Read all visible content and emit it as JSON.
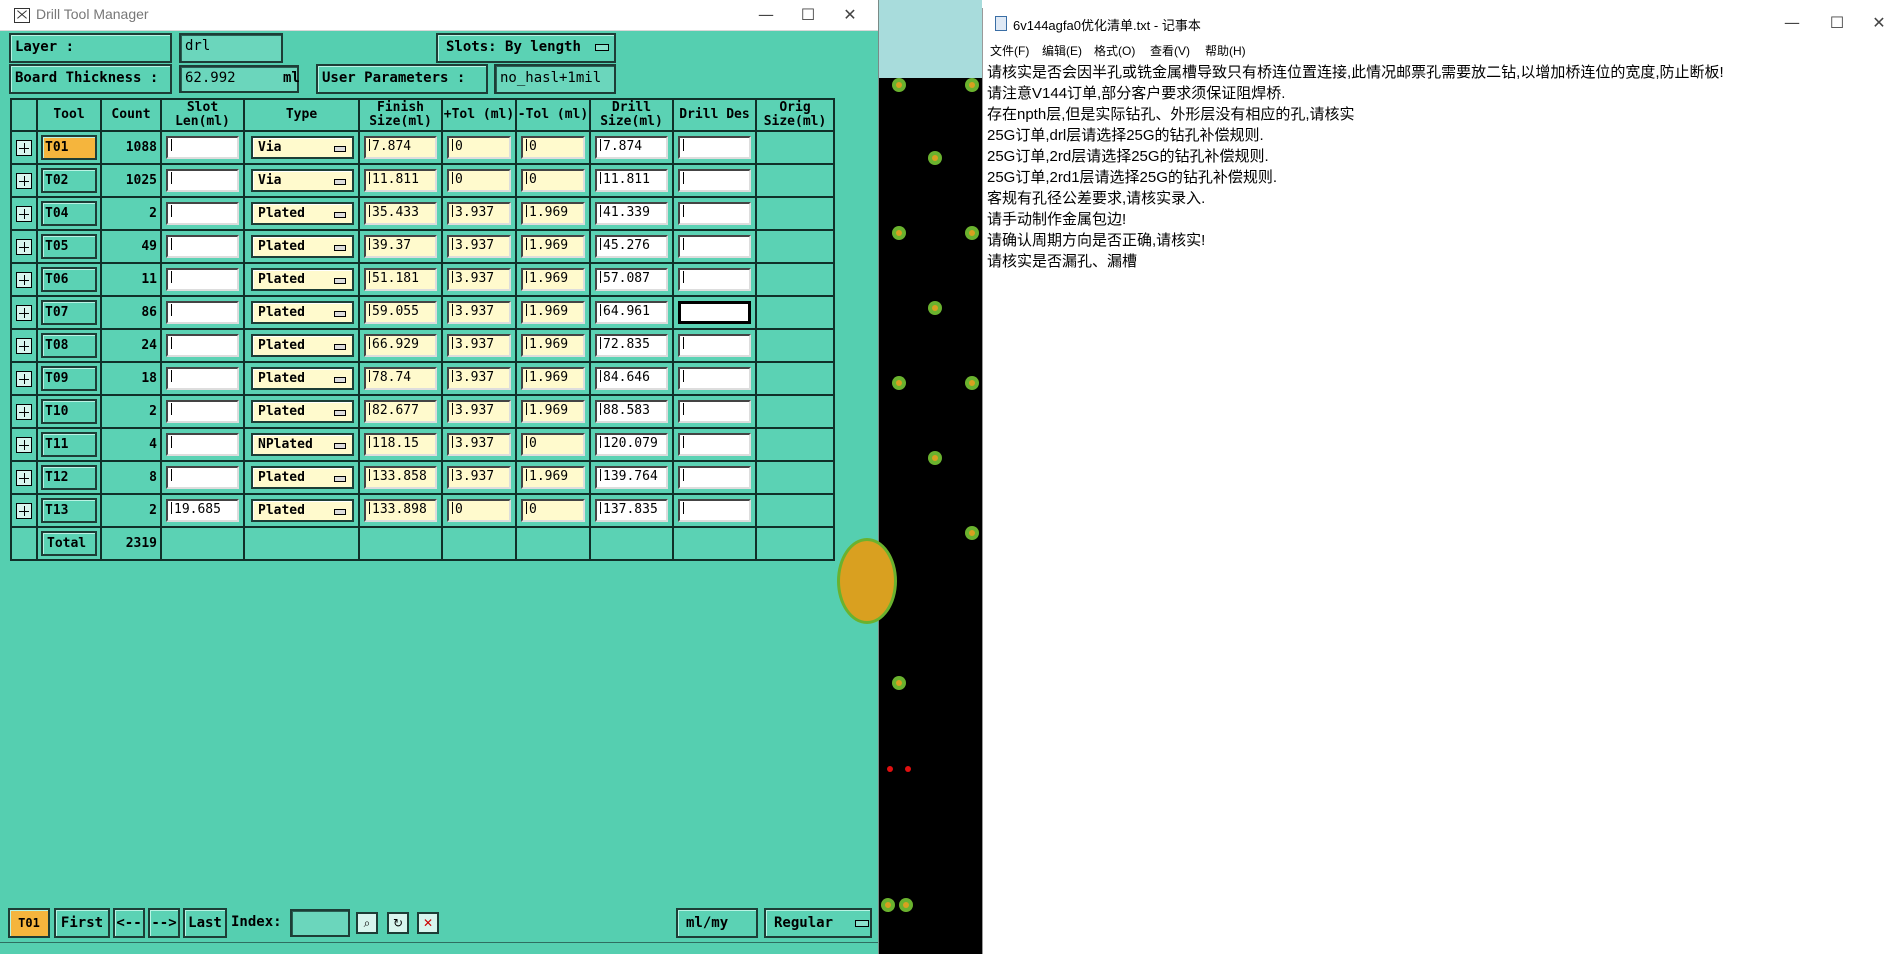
{
  "drill_manager": {
    "title": "Drill Tool Manager",
    "layer_label": "Layer        :",
    "layer_value": "drl",
    "slots_label": "Slots:",
    "slots_value": "By length",
    "thickness_label": "Board Thickness :",
    "thickness_value": "62.992",
    "thickness_unit": "ml",
    "user_params_label": "User Parameters :",
    "user_params_value": "no_hasl+1mil",
    "columns": [
      "Tool",
      "Count",
      "Slot Len(ml)",
      "Type",
      "Finish Size(ml)",
      "+Tol (ml)",
      "-Tol (ml)",
      "Drill Size(ml)",
      "Drill Des",
      "Orig Size(ml)"
    ],
    "rows": [
      {
        "tool": "T01",
        "count": "1088",
        "slot": "",
        "type": "Via",
        "finish": "7.874",
        "ptol": "0",
        "ntol": "0",
        "drill": "7.874",
        "des": ""
      },
      {
        "tool": "T02",
        "count": "1025",
        "slot": "",
        "type": "Via",
        "finish": "11.811",
        "ptol": "0",
        "ntol": "0",
        "drill": "11.811",
        "des": ""
      },
      {
        "tool": "T04",
        "count": "2",
        "slot": "",
        "type": "Plated",
        "finish": "35.433",
        "ptol": "3.937",
        "ntol": "1.969",
        "drill": "41.339",
        "des": ""
      },
      {
        "tool": "T05",
        "count": "49",
        "slot": "",
        "type": "Plated",
        "finish": "39.37",
        "ptol": "3.937",
        "ntol": "1.969",
        "drill": "45.276",
        "des": ""
      },
      {
        "tool": "T06",
        "count": "11",
        "slot": "",
        "type": "Plated",
        "finish": "51.181",
        "ptol": "3.937",
        "ntol": "1.969",
        "drill": "57.087",
        "des": ""
      },
      {
        "tool": "T07",
        "count": "86",
        "slot": "",
        "type": "Plated",
        "finish": "59.055",
        "ptol": "3.937",
        "ntol": "1.969",
        "drill": "64.961",
        "des": ""
      },
      {
        "tool": "T08",
        "count": "24",
        "slot": "",
        "type": "Plated",
        "finish": "66.929",
        "ptol": "3.937",
        "ntol": "1.969",
        "drill": "72.835",
        "des": ""
      },
      {
        "tool": "T09",
        "count": "18",
        "slot": "",
        "type": "Plated",
        "finish": "78.74",
        "ptol": "3.937",
        "ntol": "1.969",
        "drill": "84.646",
        "des": ""
      },
      {
        "tool": "T10",
        "count": "2",
        "slot": "",
        "type": "Plated",
        "finish": "82.677",
        "ptol": "3.937",
        "ntol": "1.969",
        "drill": "88.583",
        "des": ""
      },
      {
        "tool": "T11",
        "count": "4",
        "slot": "",
        "type": "NPlated",
        "finish": "118.15",
        "ptol": "3.937",
        "ntol": "0",
        "drill": "120.079",
        "des": ""
      },
      {
        "tool": "T12",
        "count": "8",
        "slot": "",
        "type": "Plated",
        "finish": "133.858",
        "ptol": "3.937",
        "ntol": "1.969",
        "drill": "139.764",
        "des": ""
      },
      {
        "tool": "T13",
        "count": "2",
        "slot": "19.685",
        "type": "Plated",
        "finish": "133.898",
        "ptol": "0",
        "ntol": "0",
        "drill": "137.835",
        "des": ""
      }
    ],
    "total_label": "Total",
    "total_count": "2319",
    "bottom": {
      "current_tool": "T01",
      "first": "First",
      "prev": "<--",
      "next": "-->",
      "last": "Last",
      "index_label": "Index:",
      "index_value": "",
      "units": "ml/my",
      "mode": "Regular"
    }
  },
  "notepad": {
    "title": "6v144agfa0优化清单.txt - 记事本",
    "menu": [
      "文件(F)",
      "编辑(E)",
      "格式(O)",
      "查看(V)",
      "帮助(H)"
    ],
    "lines": [
      "请核实是否会因半孔或铣金属槽导致只有桥连位置连接,此情况邮票孔需要放二钻,以增加桥连位的宽度,防止断板!",
      "请注意V144订单,部分客户要求须保证阻焊桥.",
      "存在npth层,但是实际钻孔、外形层没有相应的孔,请核实",
      "25G订单,drl层请选择25G的钻孔补偿规则.",
      "25G订单,2rd层请选择25G的钻孔补偿规则.",
      "25G订单,2rd1层请选择25G的钻孔补偿规则.",
      "客规有孔径公差要求,请核实录入.",
      "请手动制作金属包边!",
      "请确认周期方向是否正确,请核实!",
      "请核实是否漏孔、漏槽"
    ]
  },
  "colors": {
    "panel": "#55cfb0",
    "selected_tool": "#f5b53d",
    "input_yellow": "#fffacd",
    "pcb_bg": "#000000",
    "pad": "#6ab22e"
  }
}
